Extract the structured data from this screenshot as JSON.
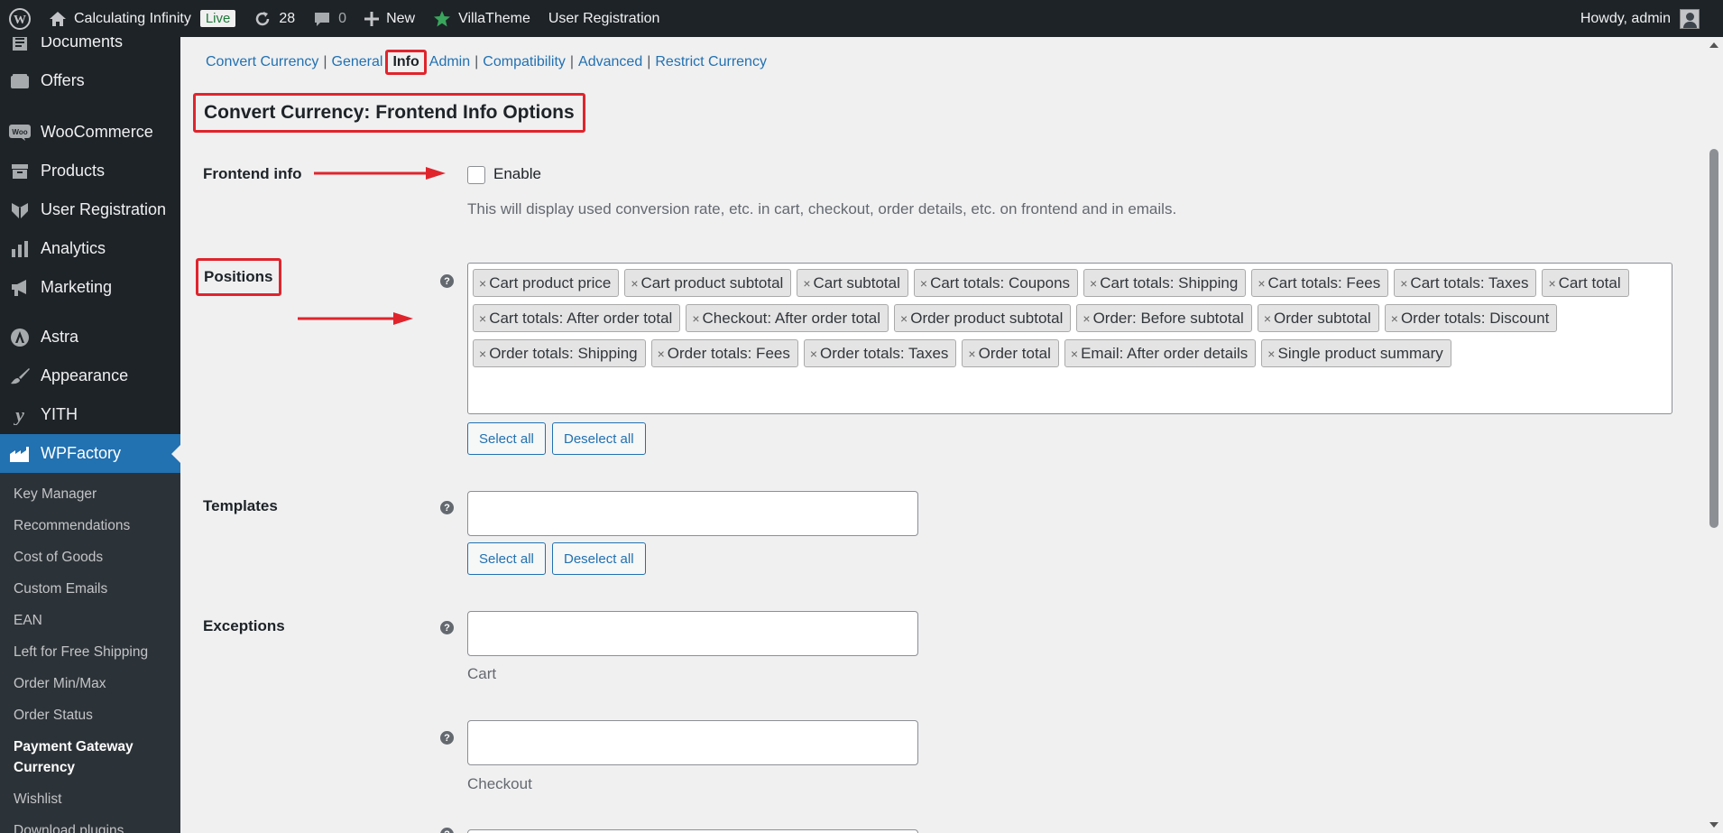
{
  "adminbar": {
    "site_name": "Calculating Infinity",
    "live_badge": "Live",
    "updates_count": "28",
    "comments_count": "0",
    "new_label": "New",
    "villatheme_label": "VillaTheme",
    "user_registration_label": "User Registration",
    "howdy": "Howdy, admin"
  },
  "sidebar": {
    "items": [
      {
        "label": "Documents",
        "icon": "document-icon"
      },
      {
        "label": "Offers",
        "icon": "offers-icon"
      },
      {
        "label": "WooCommerce",
        "icon": "woocommerce-icon"
      },
      {
        "label": "Products",
        "icon": "products-icon"
      },
      {
        "label": "User Registration",
        "icon": "user-registration-icon"
      },
      {
        "label": "Analytics",
        "icon": "analytics-icon"
      },
      {
        "label": "Marketing",
        "icon": "megaphone-icon"
      },
      {
        "label": "Astra",
        "icon": "astra-icon"
      },
      {
        "label": "Appearance",
        "icon": "brush-icon"
      },
      {
        "label": "YITH",
        "icon": "yith-icon"
      },
      {
        "label": "WPFactory",
        "icon": "wpfactory-icon"
      }
    ],
    "submenu": [
      "Key Manager",
      "Recommendations",
      "Cost of Goods",
      "Custom Emails",
      "EAN",
      "Left for Free Shipping",
      "Order Min/Max",
      "Order Status",
      "Payment Gateway Currency",
      "Wishlist",
      "Download plugins"
    ]
  },
  "tabs": {
    "convert_currency": "Convert Currency",
    "general": "General",
    "info": "Info",
    "admin": "Admin",
    "compatibility": "Compatibility",
    "advanced": "Advanced",
    "restrict_currency": "Restrict Currency",
    "sep": "|"
  },
  "section_title": "Convert Currency: Frontend Info Options",
  "frontend_info": {
    "label": "Frontend info",
    "checkbox_label": "Enable",
    "checked": false,
    "description": "This will display used conversion rate, etc. in cart, checkout, order details, etc. on frontend and in emails."
  },
  "positions": {
    "label": "Positions",
    "tokens": [
      "Cart product price",
      "Cart product subtotal",
      "Cart subtotal",
      "Cart totals: Coupons",
      "Cart totals: Shipping",
      "Cart totals: Fees",
      "Cart totals: Taxes",
      "Cart total",
      "Cart totals: After order total",
      "Checkout: After order total",
      "Order product subtotal",
      "Order: Before subtotal",
      "Order subtotal",
      "Order totals: Discount",
      "Order totals: Shipping",
      "Order totals: Fees",
      "Order totals: Taxes",
      "Order total",
      "Email: After order details",
      "Single product summary"
    ],
    "select_all": "Select all",
    "deselect_all": "Deselect all"
  },
  "templates": {
    "label": "Templates",
    "select_all": "Select all",
    "deselect_all": "Deselect all"
  },
  "exceptions": {
    "label": "Exceptions",
    "cart_desc": "Cart",
    "checkout_desc": "Checkout"
  },
  "help_glyph": "?",
  "token_remove": "×",
  "colors": {
    "accent": "#2271b1",
    "annotation_red": "#e0242c",
    "adminbar_bg": "#1d2327"
  }
}
